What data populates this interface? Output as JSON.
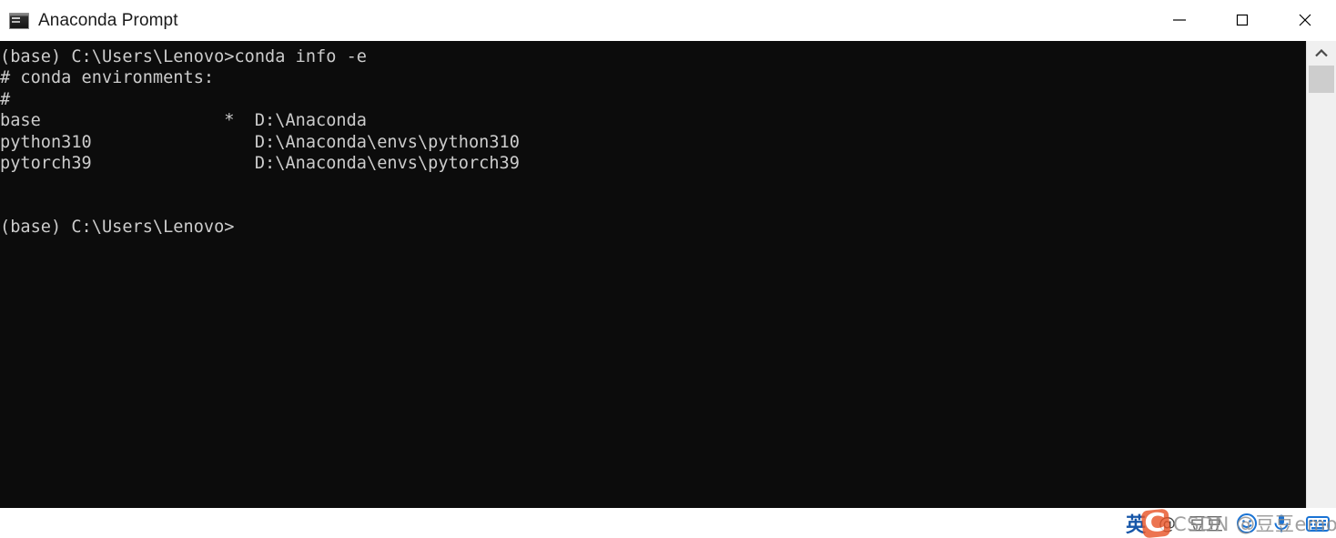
{
  "window": {
    "title": "Anaconda Prompt",
    "icon": "console-icon",
    "controls": [
      {
        "name": "minimize-button",
        "label": "Minimize",
        "glyph": "minimize"
      },
      {
        "name": "maximize-button",
        "label": "Maximize",
        "glyph": "maximize"
      },
      {
        "name": "close-button",
        "label": "Close",
        "glyph": "close"
      }
    ]
  },
  "terminal": {
    "background_color": "#0c0c0c",
    "foreground_color": "#cccccc",
    "lines": [
      "(base) C:\\Users\\Lenovo>conda info -e",
      "# conda environments:",
      "#",
      "base                  *  D:\\Anaconda",
      "python310                D:\\Anaconda\\envs\\python310",
      "pytorch39                D:\\Anaconda\\envs\\pytorch39",
      "",
      "",
      "(base) C:\\Users\\Lenovo>"
    ],
    "command": "conda info -e",
    "prompt": "(base) C:\\Users\\Lenovo>",
    "environments": [
      {
        "name": "base",
        "active": "*",
        "path": "D:\\Anaconda"
      },
      {
        "name": "python310",
        "active": "",
        "path": "D:\\Anaconda\\envs\\python310"
      },
      {
        "name": "pytorch39",
        "active": "",
        "path": "D:\\Anaconda\\envs\\pytorch39"
      }
    ]
  },
  "scrollbar": {
    "up_arrow_icon": "chevron-up-icon",
    "thumb_label": "scroll-thumb"
  },
  "ime_bar": {
    "language": "英",
    "at_symbol": "@",
    "user_name": "豆豆",
    "emoji_icon": "smiley-icon",
    "mic_icon": "microphone-icon",
    "keyboard_icon": "keyboard-icon"
  },
  "watermark": {
    "logo": "csdn-logo",
    "text": "CSDN @豆豆emon田"
  }
}
